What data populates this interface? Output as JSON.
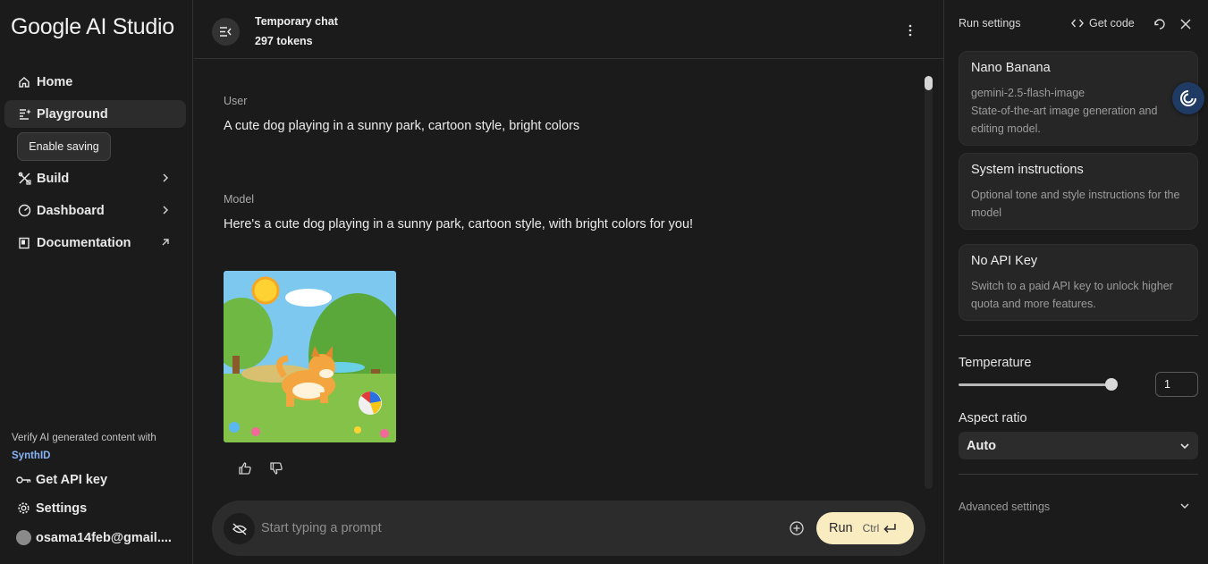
{
  "app": {
    "logo": "Google AI Studio"
  },
  "sidebar": {
    "items": [
      {
        "label": "Home",
        "icon": "home-icon"
      },
      {
        "label": "Playground",
        "icon": "playground-icon"
      },
      {
        "label": "Build",
        "icon": "build-icon"
      },
      {
        "label": "Dashboard",
        "icon": "dashboard-icon"
      },
      {
        "label": "Documentation",
        "icon": "documentation-icon"
      }
    ],
    "tooltip": "Enable saving",
    "verify_text": "Verify AI generated content with",
    "verify_link": "SynthID",
    "get_api_key": "Get API key",
    "settings": "Settings",
    "account": "osama14feb@gmail...."
  },
  "chat": {
    "title": "Temporary chat",
    "tokens": "297 tokens",
    "messages": [
      {
        "role": "User",
        "text": "A cute dog playing in a sunny park, cartoon style, bright colors"
      },
      {
        "role": "Model",
        "text": "Here's a cute dog playing in a sunny park, cartoon style, with bright colors for you!"
      }
    ],
    "prompt_placeholder": "Start typing a prompt",
    "run_label": "Run",
    "run_shortcut": "Ctrl"
  },
  "run_settings": {
    "title": "Run settings",
    "get_code": "Get code",
    "model": {
      "name": "Nano Banana",
      "id": "gemini-2.5-flash-image",
      "description": "State-of-the-art image generation and editing model."
    },
    "system_instructions": {
      "title": "System instructions",
      "description": "Optional tone and style instructions for the model"
    },
    "api_key": {
      "title": "No API Key",
      "description": "Switch to a paid API key to unlock higher quota and more features."
    },
    "temperature_label": "Temperature",
    "temperature_value": "1",
    "temperature_slider_fraction": 1.0,
    "aspect_ratio_label": "Aspect ratio",
    "aspect_ratio_value": "Auto",
    "advanced_label": "Advanced settings"
  },
  "colors": {
    "background": "#1b1b1b",
    "run_button": "#faecc1",
    "link": "#8ab4f8",
    "float_button": "#1f3a63"
  }
}
